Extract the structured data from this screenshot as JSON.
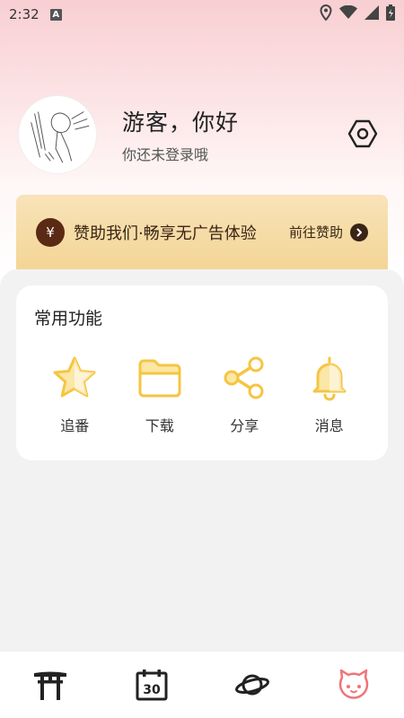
{
  "status_bar": {
    "time": "2:32",
    "notification_badge": "A",
    "icons": [
      "location-icon",
      "wifi-icon",
      "signal-icon",
      "battery-icon"
    ]
  },
  "profile": {
    "greeting": "游客，你好",
    "login_hint": "你还未登录哦",
    "settings_icon": "hexagon-settings-icon"
  },
  "sponsor_banner": {
    "icon_symbol": "¥",
    "text": "赞助我们·畅享无广告体验",
    "link_label": "前往赞助"
  },
  "common_functions": {
    "title": "常用功能",
    "items": [
      {
        "label": "追番",
        "icon": "star-icon"
      },
      {
        "label": "下载",
        "icon": "folder-icon"
      },
      {
        "label": "分享",
        "icon": "share-icon"
      },
      {
        "label": "消息",
        "icon": "bell-icon"
      }
    ]
  },
  "tab_bar": {
    "tabs": [
      {
        "icon": "torii-gate-icon",
        "active": false
      },
      {
        "icon": "calendar-30-icon",
        "calendar_text": "30",
        "active": false
      },
      {
        "icon": "planet-icon",
        "active": false
      },
      {
        "icon": "mascot-face-icon",
        "active": true
      }
    ]
  },
  "colors": {
    "accent_yellow": "#f5c542",
    "accent_yellow_fill": "#fbe7a6",
    "active_tab_pink": "#f07478",
    "sponsor_dark_brown": "#3a2415",
    "banner_gold": "#f3d595"
  }
}
